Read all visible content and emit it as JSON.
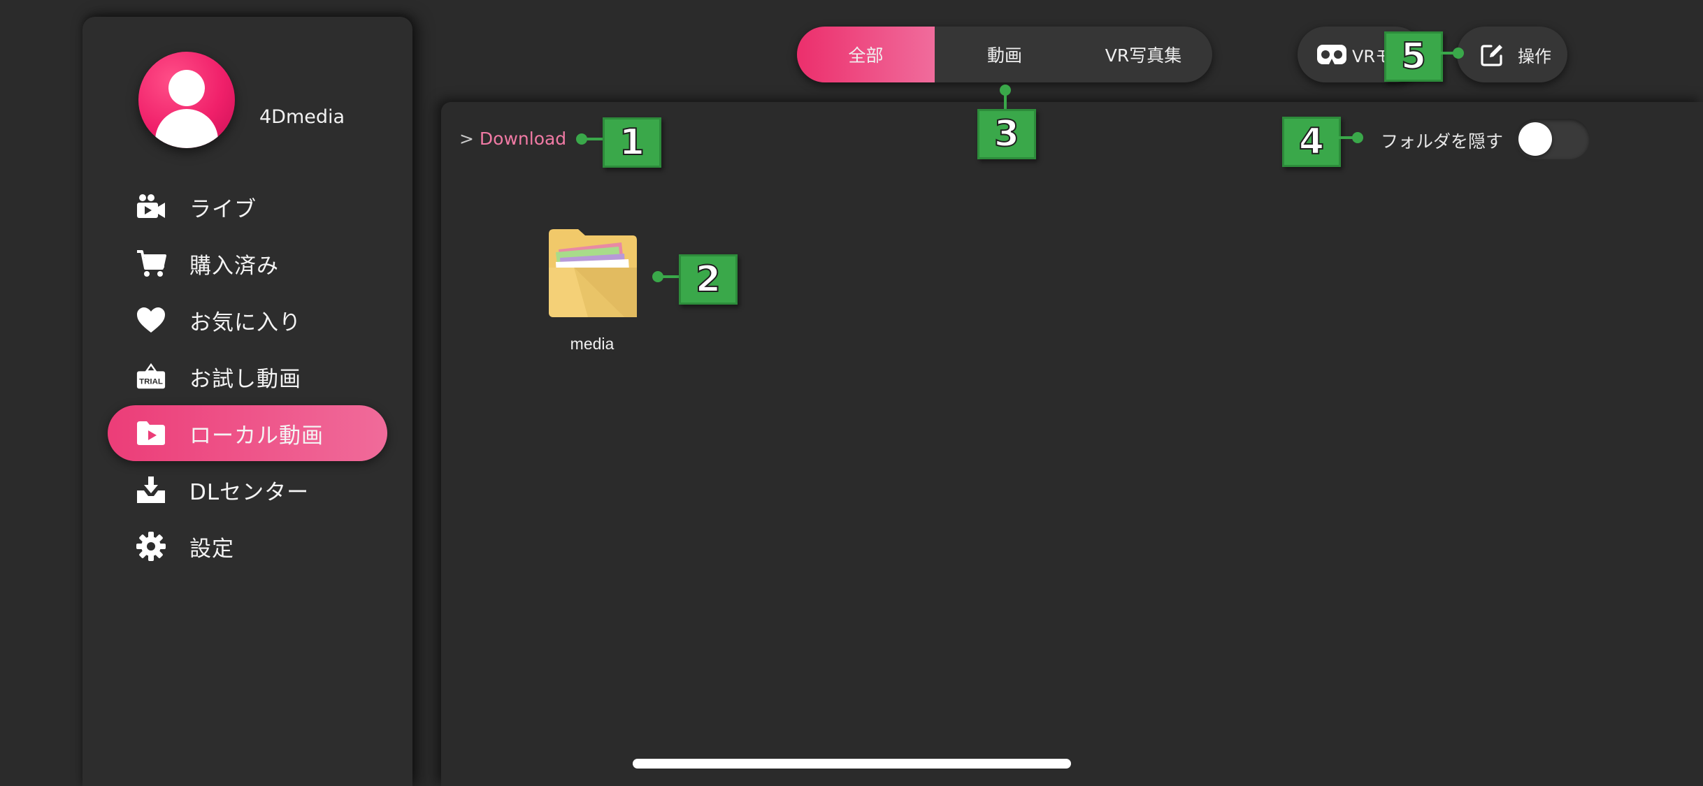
{
  "sidebar": {
    "username": "4Dmedia",
    "items": [
      {
        "label": "ライブ",
        "icon": "live-camera-icon"
      },
      {
        "label": "購入済み",
        "icon": "cart-icon"
      },
      {
        "label": "お気に入り",
        "icon": "heart-icon"
      },
      {
        "label": "お試し動画",
        "icon": "trial-icon",
        "icon_text": "TRIAL"
      },
      {
        "label": "ローカル動画",
        "icon": "local-video-folder-icon",
        "active": true
      },
      {
        "label": "DLセンター",
        "icon": "download-icon"
      },
      {
        "label": "設定",
        "icon": "gear-icon"
      }
    ]
  },
  "header": {
    "tabs": [
      {
        "label": "全部",
        "active": true
      },
      {
        "label": "動画"
      },
      {
        "label": "VR写真集"
      }
    ],
    "vr_mode_label": "VRモ",
    "operate_label": "操作"
  },
  "content": {
    "breadcrumb": {
      "separator": ">",
      "current": "Download"
    },
    "hide_folders_label": "フォルダを隠す",
    "hide_folders_on": false,
    "folders": [
      {
        "name": "media"
      }
    ]
  },
  "callouts": [
    "1",
    "2",
    "3",
    "4",
    "5"
  ],
  "colors": {
    "accent_pink": "#ec3d78",
    "background": "#2b2b2b",
    "callout_green": "#3aa84a"
  }
}
